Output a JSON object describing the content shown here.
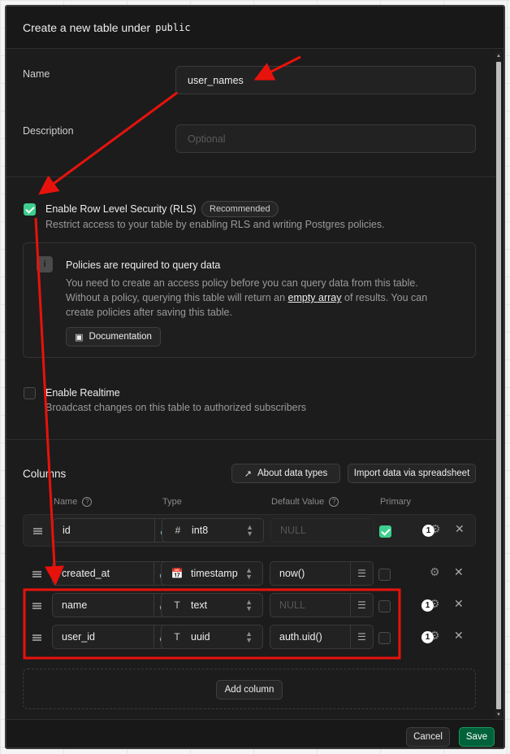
{
  "header": {
    "title": "Create a new table under",
    "schema": "public"
  },
  "form": {
    "name_label": "Name",
    "name_value": "user_names",
    "description_label": "Description",
    "description_placeholder": "Optional"
  },
  "rls": {
    "label": "Enable Row Level Security (RLS)",
    "badge": "Recommended",
    "description": "Restrict access to your table by enabling RLS and writing Postgres policies.",
    "checked": true
  },
  "notice": {
    "title": "Policies are required to query data",
    "line1": "You need to create an access policy before you can query data from this table.",
    "line2_pre": "Without a policy, querying this table will return an ",
    "line2_link": "empty array",
    "line2_post": " of results. You can",
    "line3": "create policies after saving this table.",
    "doc_button": "Documentation"
  },
  "realtime": {
    "label": "Enable Realtime",
    "description": "Broadcast changes on this table to authorized subscribers",
    "checked": false
  },
  "columns": {
    "title": "Columns",
    "about_button": "About data types",
    "import_button": "Import data via spreadsheet",
    "headers": {
      "name": "Name",
      "type": "Type",
      "default": "Default Value",
      "primary": "Primary"
    },
    "rows": [
      {
        "name": "id",
        "type_icon": "#",
        "type": "int8",
        "default": "NULL",
        "default_placeholder": true,
        "primary": true,
        "count": "1"
      },
      {
        "name": "created_at",
        "type_icon": "calendar",
        "type": "timestamptz",
        "default": "now()",
        "default_placeholder": false,
        "primary": false,
        "count": ""
      },
      {
        "name": "name",
        "type_icon": "T",
        "type": "text",
        "default": "NULL",
        "default_placeholder": true,
        "primary": false,
        "count": "1"
      },
      {
        "name": "user_id",
        "type_icon": "T",
        "type": "uuid",
        "default": "auth.uid()",
        "default_placeholder": false,
        "primary": false,
        "count": "1"
      }
    ],
    "add_button": "Add column"
  },
  "footer": {
    "cancel": "Cancel",
    "save": "Save"
  },
  "colors": {
    "accent": "#3ecf8e",
    "save_bg": "#006239",
    "annotation": "#e8120c"
  }
}
